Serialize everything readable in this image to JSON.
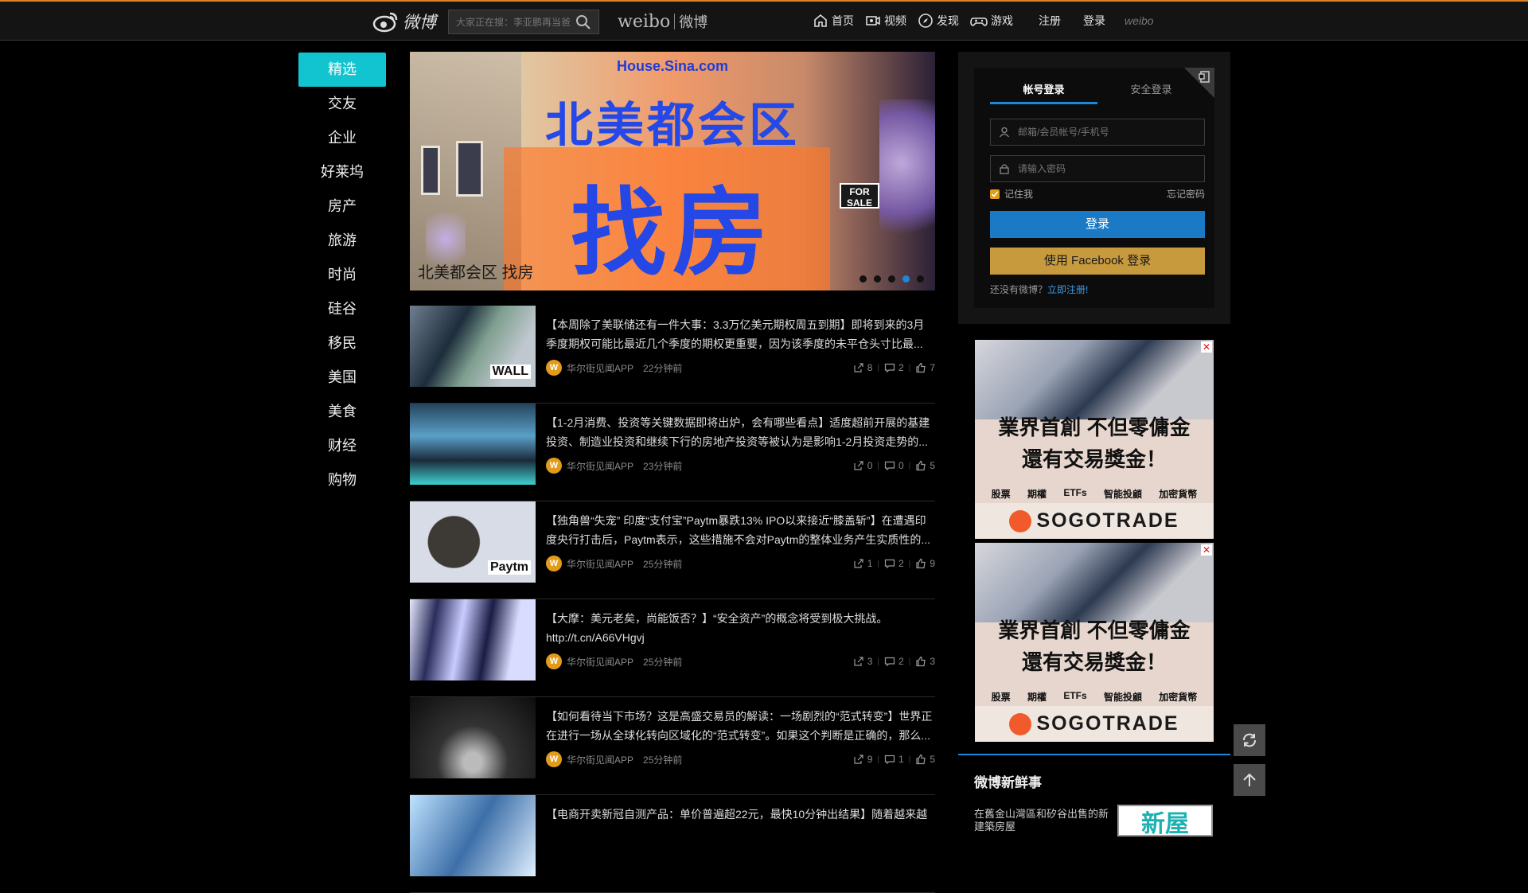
{
  "header": {
    "logo_text": "微博",
    "search_placeholder": "大家正在搜：李亚鹏再当爸",
    "brand_en": "weibo",
    "brand_cn": "微博",
    "nav": [
      {
        "label": "首页",
        "icon": "home-icon"
      },
      {
        "label": "视频",
        "icon": "video-icon"
      },
      {
        "label": "发现",
        "icon": "compass-icon"
      },
      {
        "label": "游戏",
        "icon": "gamepad-icon"
      }
    ],
    "register": "注册",
    "login": "登录",
    "weibo_mark": "weibo"
  },
  "sidebar": {
    "categories": [
      "精选",
      "交友",
      "企业",
      "好莱坞",
      "房产",
      "旅游",
      "时尚",
      "硅谷",
      "移民",
      "美国",
      "美食",
      "财经",
      "购物"
    ],
    "active_index": 0
  },
  "banner": {
    "url_text": "House.Sina.com",
    "headline": "北美都会区",
    "subheadline": "找房",
    "sale_sign": "FOR SALE",
    "caption": "北美都会区 找房",
    "slide_count": 5,
    "active_slide": 3
  },
  "feed": [
    {
      "title": "【本周除了美联储还有一件大事：3.3万亿美元期权周五到期】即将到来的3月季度期权可能比最近几个季度的期权更重要，因为该季度的未平仓头寸比最...",
      "source": "华尔街见闻APP",
      "time": "22分钟前",
      "shares": "8",
      "comments": "2",
      "likes": "7",
      "thumb_text": "WALL"
    },
    {
      "title": "【1-2月消费、投资等关键数据即将出炉，会有哪些看点】适度超前开展的基建投资、制造业投资和继续下行的房地产投资等被认为是影响1-2月投资走势的...",
      "source": "华尔街见闻APP",
      "time": "23分钟前",
      "shares": "0",
      "comments": "0",
      "likes": "5",
      "thumb_text": ""
    },
    {
      "title": "【独角兽“失宠” 印度“支付宝”Paytm暴跌13% IPO以来接近“膝盖斩”】在遭遇印度央行打击后，Paytm表示，这些措施不会对Paytm的整体业务产生实质性的...",
      "source": "华尔街见闻APP",
      "time": "25分钟前",
      "shares": "1",
      "comments": "2",
      "likes": "9",
      "thumb_text": "Paytm"
    },
    {
      "title": "【大摩：美元老矣，尚能饭否？】“安全资产”的概念将受到极大挑战。http://t.cn/A66VHgvj",
      "source": "华尔街见闻APP",
      "time": "25分钟前",
      "shares": "3",
      "comments": "2",
      "likes": "3",
      "thumb_text": ""
    },
    {
      "title": "【如何看待当下市场？这是高盛交易员的解读：一场剧烈的“范式转变”】世界正在进行一场从全球化转向区域化的“范式转变”。如果这个判断是正确的，那么...",
      "source": "华尔街见闻APP",
      "time": "25分钟前",
      "shares": "9",
      "comments": "1",
      "likes": "5",
      "thumb_text": ""
    },
    {
      "title": "【电商开卖新冠自测产品：单价普遍超22元，最快10分钟出结果】随着越来越",
      "source": "",
      "time": "",
      "shares": "",
      "comments": "",
      "likes": "",
      "thumb_text": ""
    }
  ],
  "login": {
    "tab_account": "帐号登录",
    "tab_secure": "安全登录",
    "username_placeholder": "邮箱/会员帐号/手机号",
    "password_placeholder": "请输入密码",
    "remember": "记住我",
    "forgot": "忘记密码",
    "login_button": "登录",
    "facebook_button": "使用 Facebook 登录",
    "no_account": "还没有微博？",
    "register_link": "立即注册!"
  },
  "ads": [
    {
      "line1": "業界首創  不但零傭金",
      "line2": "還有交易獎金！",
      "tags": [
        "股票",
        "期權",
        "ETFs",
        "智能投顧",
        "加密貨幣"
      ],
      "brand": "SOGOTRADE",
      "close": "✕"
    },
    {
      "line1": "業界首創  不但零傭金",
      "line2": "還有交易獎金！",
      "tags": [
        "股票",
        "期權",
        "ETFs",
        "智能投顧",
        "加密貨幣"
      ],
      "brand": "SOGOTRADE",
      "close": "✕"
    }
  ],
  "weibo_news": {
    "heading": "微博新鲜事",
    "item_text": "在舊金山灣區和矽谷出售的新建築房屋",
    "image_text": "新屋"
  },
  "colors": {
    "accent_blue": "#1e87d8",
    "sidebar_active": "#12c4cf",
    "facebook_gold": "#c89a3e",
    "source_orange": "#e39b1a"
  }
}
